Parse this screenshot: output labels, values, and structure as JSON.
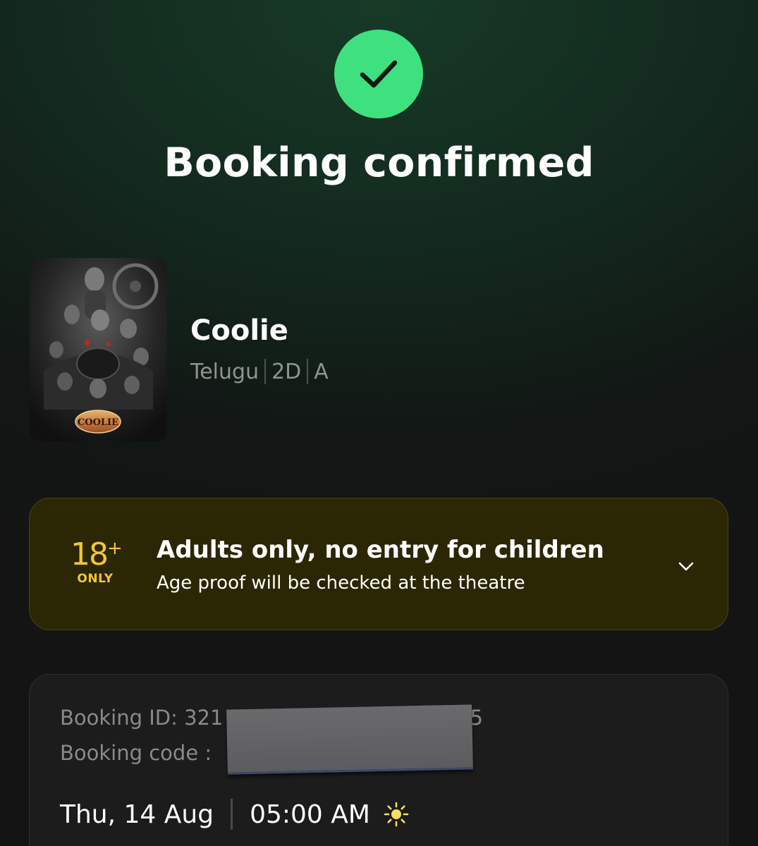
{
  "status": {
    "icon": "check-icon",
    "title": "Booking confirmed",
    "accent_color": "#3fe07f"
  },
  "movie": {
    "name": "Coolie",
    "language": "Telugu",
    "format": "2D",
    "rating": "A",
    "poster_icon": "movie-poster",
    "poster_logo": "COOLIE"
  },
  "age_warning": {
    "badge_number": "18",
    "badge_plus": "+",
    "badge_label": "ONLY",
    "title": "Adults only, no entry for children",
    "subtitle": "Age proof will be checked at the theatre",
    "expand_icon": "chevron-down-icon",
    "background_color": "#2b2705",
    "badge_color": "#f2c53a"
  },
  "booking": {
    "id_label": "Booking ID: 321",
    "id_suffix": "5",
    "code_label": "Booking code :",
    "redacted": true,
    "date": "Thu, 14 Aug",
    "time": "05:00 AM",
    "time_icon": "sun-icon"
  }
}
